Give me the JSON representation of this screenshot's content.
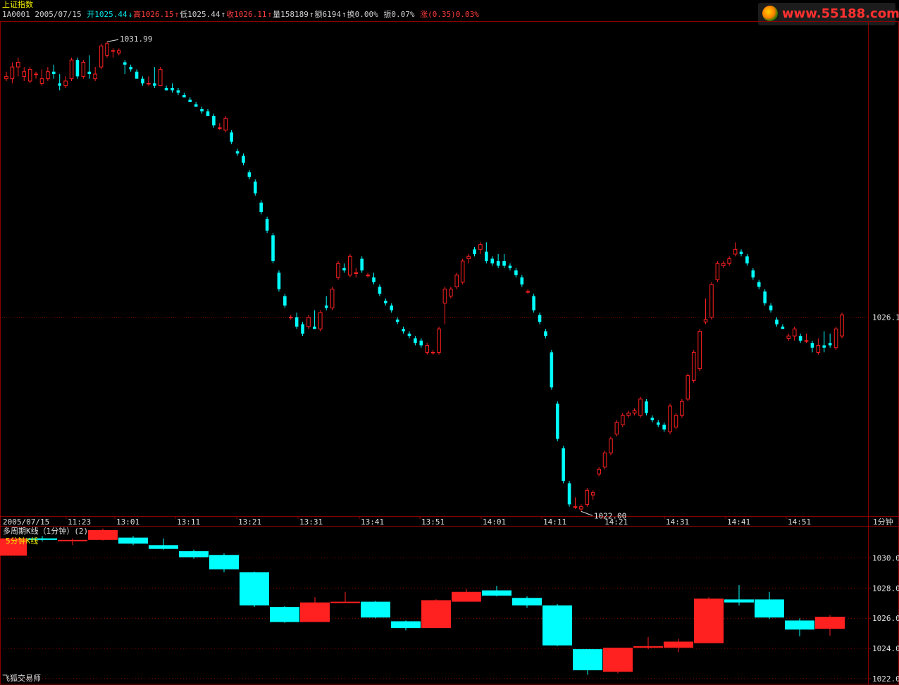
{
  "header": {
    "index_name": "上证指数",
    "code": "1A0001",
    "date": "2005/07/15",
    "open_label": "开",
    "open": "1025.44",
    "open_arrow": "↓",
    "high_label": "高",
    "high": "1026.15",
    "high_arrow": "↑",
    "low_label": "低",
    "low": "1025.44",
    "low_arrow": "↑",
    "close_label": "收",
    "close": "1026.11",
    "close_arrow": "↑",
    "volume_label": "量",
    "volume": "158189",
    "volume_arrow": "↑",
    "amount_label": "额",
    "amount": "6194",
    "amount_arrow": "↑",
    "turnover_label": "换",
    "turnover": "0.00%",
    "amplitude_label": "振",
    "amplitude": "0.07%",
    "change_label": "涨",
    "change": "(0.35)",
    "change_pct": "0.03%"
  },
  "logo": {
    "text": "www.55188.com"
  },
  "colors": {
    "up": "#ff2020",
    "down": "#00ffff",
    "grid": "#8b0000",
    "axis_text": "#e0e0e0"
  },
  "main_chart": {
    "max_label": "1031.99",
    "min_label": "1022.00",
    "price_line_label": "1026.1",
    "period_label": "1分钟",
    "x_labels": [
      "2005/07/15",
      "11:23",
      "13:01",
      "13:11",
      "13:21",
      "13:31",
      "13:41",
      "13:51",
      "14:01",
      "14:11",
      "14:21",
      "14:31",
      "14:41",
      "14:51"
    ]
  },
  "sub_chart": {
    "title": "多周期K线（1分钟）(2)",
    "sub_title": "5分钟K线",
    "y_labels": [
      "1030.0",
      "1028.0",
      "1026.0",
      "1024.0",
      "1022.0"
    ]
  },
  "footer": {
    "app_name": "飞狐交易师"
  },
  "chart_data": [
    {
      "type": "candlestick",
      "title": "上证指数",
      "period": "1分钟",
      "ylim": [
        1021.85,
        1032.4
      ],
      "price_line": 1026.1,
      "x_tick_labels": [
        "2005/07/15",
        "11:23",
        "13:01",
        "13:11",
        "13:21",
        "13:31",
        "13:41",
        "13:51",
        "14:01",
        "14:11",
        "14:21",
        "14:31",
        "14:41",
        "14:51"
      ],
      "candles": [
        [
          1031.2,
          1031.35,
          1031.15,
          1031.25
        ],
        [
          1031.2,
          1031.55,
          1031.1,
          1031.45
        ],
        [
          1031.45,
          1031.65,
          1031.25,
          1031.55
        ],
        [
          1031.25,
          1031.45,
          1031.15,
          1031.35
        ],
        [
          1031.15,
          1031.45,
          1031.1,
          1031.4
        ],
        [
          1031.3,
          1031.35,
          1031.2,
          1031.3
        ],
        [
          1031.1,
          1031.4,
          1031.05,
          1031.2
        ],
        [
          1031.2,
          1031.45,
          1031.15,
          1031.35
        ],
        [
          1031.35,
          1031.5,
          1031.2,
          1031.3
        ],
        [
          1031.1,
          1031.3,
          1030.95,
          1031.05
        ],
        [
          1031.05,
          1031.25,
          1031.0,
          1031.15
        ],
        [
          1031.2,
          1031.65,
          1031.15,
          1031.6
        ],
        [
          1031.6,
          1031.65,
          1031.2,
          1031.25
        ],
        [
          1031.25,
          1031.6,
          1031.2,
          1031.55
        ],
        [
          1031.35,
          1031.7,
          1031.2,
          1031.3
        ],
        [
          1031.2,
          1031.45,
          1031.15,
          1031.3
        ],
        [
          1031.45,
          1031.95,
          1031.4,
          1031.9
        ],
        [
          1031.7,
          1031.99,
          1031.65,
          1031.95
        ],
        [
          1031.8,
          1031.85,
          1031.65,
          1031.8
        ],
        [
          1031.75,
          1031.85,
          1031.7,
          1031.8
        ],
        [
          1031.55,
          1031.6,
          1031.3,
          1031.5
        ],
        [
          1031.45,
          1031.5,
          1031.35,
          1031.4
        ],
        [
          1031.35,
          1031.4,
          1031.25,
          1031.2
        ],
        [
          1031.2,
          1031.25,
          1031.05,
          1031.1
        ],
        [
          1031.1,
          1031.25,
          1031.05,
          1031.1
        ],
        [
          1031.1,
          1031.45,
          1031.0,
          1031.05
        ],
        [
          1031.05,
          1031.45,
          1031.05,
          1031.4
        ],
        [
          1031.0,
          1031.05,
          1030.95,
          1030.95
        ],
        [
          1031.0,
          1031.1,
          1030.9,
          1030.95
        ],
        [
          1030.95,
          1031.0,
          1030.85,
          1030.9
        ],
        [
          1030.85,
          1030.9,
          1030.8,
          1030.8
        ],
        [
          1030.75,
          1030.8,
          1030.7,
          1030.7
        ],
        [
          1030.65,
          1030.7,
          1030.6,
          1030.6
        ],
        [
          1030.55,
          1030.6,
          1030.45,
          1030.5
        ],
        [
          1030.5,
          1030.55,
          1030.4,
          1030.4
        ],
        [
          1030.4,
          1030.45,
          1030.15,
          1030.2
        ],
        [
          1030.15,
          1030.25,
          1030.1,
          1030.15
        ],
        [
          1030.1,
          1030.4,
          1030.05,
          1030.35
        ],
        [
          1030.05,
          1030.1,
          1029.8,
          1029.85
        ],
        [
          1029.65,
          1029.7,
          1029.55,
          1029.6
        ],
        [
          1029.55,
          1029.6,
          1029.35,
          1029.4
        ],
        [
          1029.2,
          1029.25,
          1029.05,
          1029.1
        ],
        [
          1029.0,
          1029.05,
          1028.7,
          1028.75
        ],
        [
          1028.55,
          1028.6,
          1028.3,
          1028.35
        ],
        [
          1028.2,
          1028.25,
          1027.9,
          1027.95
        ],
        [
          1027.85,
          1027.9,
          1027.25,
          1027.3
        ],
        [
          1027.05,
          1027.1,
          1026.65,
          1026.7
        ],
        [
          1026.55,
          1026.6,
          1026.3,
          1026.35
        ],
        [
          1026.1,
          1026.15,
          1026.05,
          1026.1
        ],
        [
          1026.1,
          1026.2,
          1025.85,
          1025.9
        ],
        [
          1025.95,
          1026.0,
          1025.7,
          1025.75
        ],
        [
          1025.9,
          1026.15,
          1025.85,
          1026.1
        ],
        [
          1025.9,
          1026.25,
          1025.85,
          1025.85
        ],
        [
          1025.85,
          1026.25,
          1025.8,
          1026.2
        ],
        [
          1026.35,
          1026.55,
          1026.25,
          1026.3
        ],
        [
          1026.3,
          1026.75,
          1026.25,
          1026.7
        ],
        [
          1026.95,
          1027.3,
          1026.9,
          1027.25
        ],
        [
          1027.15,
          1027.25,
          1027.05,
          1027.1
        ],
        [
          1027.0,
          1027.45,
          1026.95,
          1027.4
        ],
        [
          1027.05,
          1027.15,
          1026.95,
          1027.05
        ],
        [
          1027.35,
          1027.4,
          1027.05,
          1027.1
        ],
        [
          1027.0,
          1027.05,
          1026.95,
          1027.0
        ],
        [
          1026.95,
          1027.05,
          1026.8,
          1026.85
        ],
        [
          1026.75,
          1026.8,
          1026.55,
          1026.6
        ],
        [
          1026.45,
          1026.5,
          1026.35,
          1026.4
        ],
        [
          1026.35,
          1026.4,
          1026.2,
          1026.25
        ],
        [
          1026.05,
          1026.1,
          1025.95,
          1026.0
        ],
        [
          1025.85,
          1025.9,
          1025.75,
          1025.8
        ],
        [
          1025.75,
          1025.8,
          1025.65,
          1025.7
        ],
        [
          1025.65,
          1025.7,
          1025.5,
          1025.55
        ],
        [
          1025.6,
          1025.65,
          1025.45,
          1025.5
        ],
        [
          1025.35,
          1025.55,
          1025.3,
          1025.5
        ],
        [
          1025.35,
          1025.4,
          1025.3,
          1025.35
        ],
        [
          1025.35,
          1025.9,
          1025.3,
          1025.85
        ],
        [
          1026.4,
          1026.75,
          1025.95,
          1026.7
        ],
        [
          1026.55,
          1026.75,
          1026.5,
          1026.7
        ],
        [
          1026.75,
          1027.05,
          1026.7,
          1027.0
        ],
        [
          1026.85,
          1027.35,
          1026.8,
          1027.3
        ],
        [
          1027.35,
          1027.45,
          1027.25,
          1027.4
        ],
        [
          1027.55,
          1027.6,
          1027.4,
          1027.45
        ],
        [
          1027.55,
          1027.7,
          1027.45,
          1027.65
        ],
        [
          1027.5,
          1027.7,
          1027.25,
          1027.3
        ],
        [
          1027.35,
          1027.4,
          1027.2,
          1027.25
        ],
        [
          1027.3,
          1027.45,
          1027.15,
          1027.2
        ],
        [
          1027.3,
          1027.45,
          1027.15,
          1027.2
        ],
        [
          1027.2,
          1027.25,
          1027.1,
          1027.15
        ],
        [
          1027.1,
          1027.15,
          1026.95,
          1027.0
        ],
        [
          1026.95,
          1027.0,
          1026.75,
          1026.8
        ],
        [
          1026.65,
          1026.7,
          1026.6,
          1026.65
        ],
        [
          1026.55,
          1026.6,
          1026.2,
          1026.25
        ],
        [
          1026.15,
          1026.2,
          1025.95,
          1026.0
        ],
        [
          1025.8,
          1025.85,
          1025.65,
          1025.7
        ],
        [
          1025.35,
          1025.4,
          1024.55,
          1024.6
        ],
        [
          1024.25,
          1024.3,
          1023.45,
          1023.5
        ],
        [
          1023.3,
          1023.35,
          1022.55,
          1022.6
        ],
        [
          1022.55,
          1022.6,
          1022.05,
          1022.1
        ],
        [
          1022.05,
          1022.25,
          1022.0,
          1022.05
        ],
        [
          1022.0,
          1022.1,
          1021.95,
          1022.05
        ],
        [
          1022.1,
          1022.45,
          1022.05,
          1022.4
        ],
        [
          1022.3,
          1022.4,
          1022.2,
          1022.35
        ],
        [
          1022.75,
          1022.9,
          1022.7,
          1022.85
        ],
        [
          1022.9,
          1023.25,
          1022.85,
          1023.2
        ],
        [
          1023.2,
          1023.55,
          1023.15,
          1023.5
        ],
        [
          1023.6,
          1023.9,
          1023.55,
          1023.85
        ],
        [
          1023.8,
          1024.05,
          1023.75,
          1024.0
        ],
        [
          1024.0,
          1024.1,
          1023.95,
          1024.05
        ],
        [
          1024.05,
          1024.15,
          1024.0,
          1024.1
        ],
        [
          1024.0,
          1024.4,
          1023.95,
          1024.35
        ],
        [
          1024.3,
          1024.35,
          1024.0,
          1024.05
        ],
        [
          1023.95,
          1024.0,
          1023.85,
          1023.9
        ],
        [
          1023.85,
          1023.9,
          1023.75,
          1023.8
        ],
        [
          1023.8,
          1023.85,
          1023.65,
          1023.7
        ],
        [
          1023.65,
          1024.25,
          1023.6,
          1024.2
        ],
        [
          1023.75,
          1024.05,
          1023.7,
          1024.0
        ],
        [
          1024.0,
          1024.35,
          1023.95,
          1024.3
        ],
        [
          1024.35,
          1024.9,
          1024.3,
          1024.85
        ],
        [
          1024.75,
          1025.4,
          1024.7,
          1025.35
        ],
        [
          1025.0,
          1025.85,
          1024.95,
          1025.8
        ],
        [
          1026.0,
          1026.5,
          1025.95,
          1026.05
        ],
        [
          1026.1,
          1026.85,
          1026.05,
          1026.8
        ],
        [
          1026.9,
          1027.3,
          1026.85,
          1027.25
        ],
        [
          1027.2,
          1027.3,
          1027.15,
          1027.25
        ],
        [
          1027.25,
          1027.4,
          1027.2,
          1027.35
        ],
        [
          1027.45,
          1027.7,
          1027.4,
          1027.55
        ],
        [
          1027.5,
          1027.55,
          1027.4,
          1027.45
        ],
        [
          1027.4,
          1027.45,
          1027.2,
          1027.25
        ],
        [
          1027.1,
          1027.15,
          1026.9,
          1026.95
        ],
        [
          1026.85,
          1026.9,
          1026.7,
          1026.75
        ],
        [
          1026.65,
          1026.7,
          1026.35,
          1026.4
        ],
        [
          1026.35,
          1026.4,
          1026.2,
          1026.25
        ],
        [
          1026.05,
          1026.1,
          1025.9,
          1025.95
        ],
        [
          1025.9,
          1025.95,
          1025.85,
          1025.85
        ],
        [
          1025.65,
          1025.75,
          1025.6,
          1025.7
        ],
        [
          1025.7,
          1025.9,
          1025.6,
          1025.85
        ],
        [
          1025.7,
          1025.75,
          1025.55,
          1025.6
        ],
        [
          1025.6,
          1025.75,
          1025.55,
          1025.6
        ],
        [
          1025.55,
          1025.6,
          1025.35,
          1025.45
        ],
        [
          1025.35,
          1025.65,
          1025.3,
          1025.5
        ],
        [
          1025.5,
          1025.8,
          1025.35,
          1025.45
        ],
        [
          1025.55,
          1025.75,
          1025.45,
          1025.5
        ],
        [
          1025.45,
          1025.9,
          1025.4,
          1025.85
        ],
        [
          1025.7,
          1026.2,
          1025.65,
          1026.15
        ]
      ]
    },
    {
      "type": "candlestick",
      "title": "多周期K线（1分钟）(2)",
      "subtitle": "5分钟K线",
      "ylim": [
        1021.9,
        1031.8
      ],
      "y_ticks": [
        1030.0,
        1028.0,
        1026.0,
        1024.0,
        1022.0
      ],
      "candles": [
        [
          1030.15,
          1031.35,
          1030.15,
          1031.3
        ],
        [
          1031.3,
          1031.45,
          1031.1,
          1031.2
        ],
        [
          1031.2,
          1031.3,
          1030.85,
          1031.2
        ],
        [
          1031.2,
          1031.95,
          1031.15,
          1031.85
        ],
        [
          1031.35,
          1031.45,
          1030.85,
          1030.95
        ],
        [
          1030.85,
          1031.3,
          1030.55,
          1030.6
        ],
        [
          1030.45,
          1030.55,
          1029.95,
          1030.05
        ],
        [
          1030.2,
          1030.3,
          1029.05,
          1029.25
        ],
        [
          1029.05,
          1029.1,
          1026.75,
          1026.85
        ],
        [
          1026.75,
          1026.8,
          1025.7,
          1025.75
        ],
        [
          1025.75,
          1027.4,
          1025.75,
          1027.05
        ],
        [
          1027.1,
          1027.75,
          1027.05,
          1027.1
        ],
        [
          1027.1,
          1027.15,
          1026.0,
          1026.05
        ],
        [
          1025.8,
          1025.85,
          1025.2,
          1025.35
        ],
        [
          1025.35,
          1027.25,
          1025.35,
          1027.2
        ],
        [
          1027.1,
          1027.95,
          1027.1,
          1027.75
        ],
        [
          1027.85,
          1028.15,
          1027.45,
          1027.5
        ],
        [
          1027.35,
          1027.45,
          1026.7,
          1026.85
        ],
        [
          1026.85,
          1026.95,
          1024.15,
          1024.2
        ],
        [
          1023.95,
          1023.95,
          1022.25,
          1022.55
        ],
        [
          1022.45,
          1024.05,
          1022.35,
          1024.05
        ],
        [
          1024.05,
          1024.75,
          1023.95,
          1024.15
        ],
        [
          1024.05,
          1024.65,
          1023.75,
          1024.45
        ],
        [
          1024.35,
          1027.4,
          1024.35,
          1027.3
        ],
        [
          1027.25,
          1028.2,
          1026.85,
          1027.05
        ],
        [
          1027.25,
          1027.75,
          1025.95,
          1026.05
        ],
        [
          1025.85,
          1026.0,
          1024.8,
          1025.25
        ],
        [
          1025.3,
          1026.2,
          1024.85,
          1026.1
        ]
      ]
    }
  ]
}
